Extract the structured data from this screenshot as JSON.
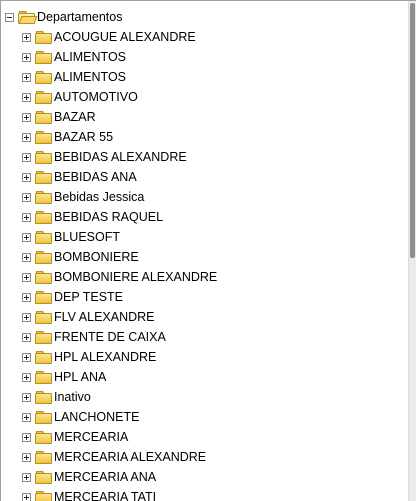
{
  "tree": {
    "root": {
      "label": "Departamentos",
      "expander": "minus",
      "icon": "folder-open-icon"
    },
    "items": [
      {
        "label": "ACOUGUE ALEXANDRE"
      },
      {
        "label": "ALIMENTOS"
      },
      {
        "label": "ALIMENTOS"
      },
      {
        "label": "AUTOMOTIVO"
      },
      {
        "label": "BAZAR"
      },
      {
        "label": "BAZAR 55"
      },
      {
        "label": "BEBIDAS ALEXANDRE"
      },
      {
        "label": "BEBIDAS ANA"
      },
      {
        "label": "Bebidas Jessica"
      },
      {
        "label": "BEBIDAS RAQUEL"
      },
      {
        "label": "BLUESOFT"
      },
      {
        "label": "BOMBONIERE"
      },
      {
        "label": "BOMBONIERE ALEXANDRE"
      },
      {
        "label": "DEP TESTE"
      },
      {
        "label": "FLV ALEXANDRE"
      },
      {
        "label": "FRENTE DE CAIXA"
      },
      {
        "label": "HPL ALEXANDRE"
      },
      {
        "label": "HPL ANA"
      },
      {
        "label": "Inativo"
      },
      {
        "label": "LANCHONETE"
      },
      {
        "label": "MERCEARIA"
      },
      {
        "label": "MERCEARIA ALEXANDRE"
      },
      {
        "label": "MERCEARIA ANA"
      },
      {
        "label": "MERCEARIA TATI"
      }
    ]
  },
  "colors": {
    "folder_fill": "#eec43f",
    "folder_border": "#b68f1c",
    "scroll_track": "#ebebeb",
    "scroll_thumb": "#8f8f8f"
  }
}
